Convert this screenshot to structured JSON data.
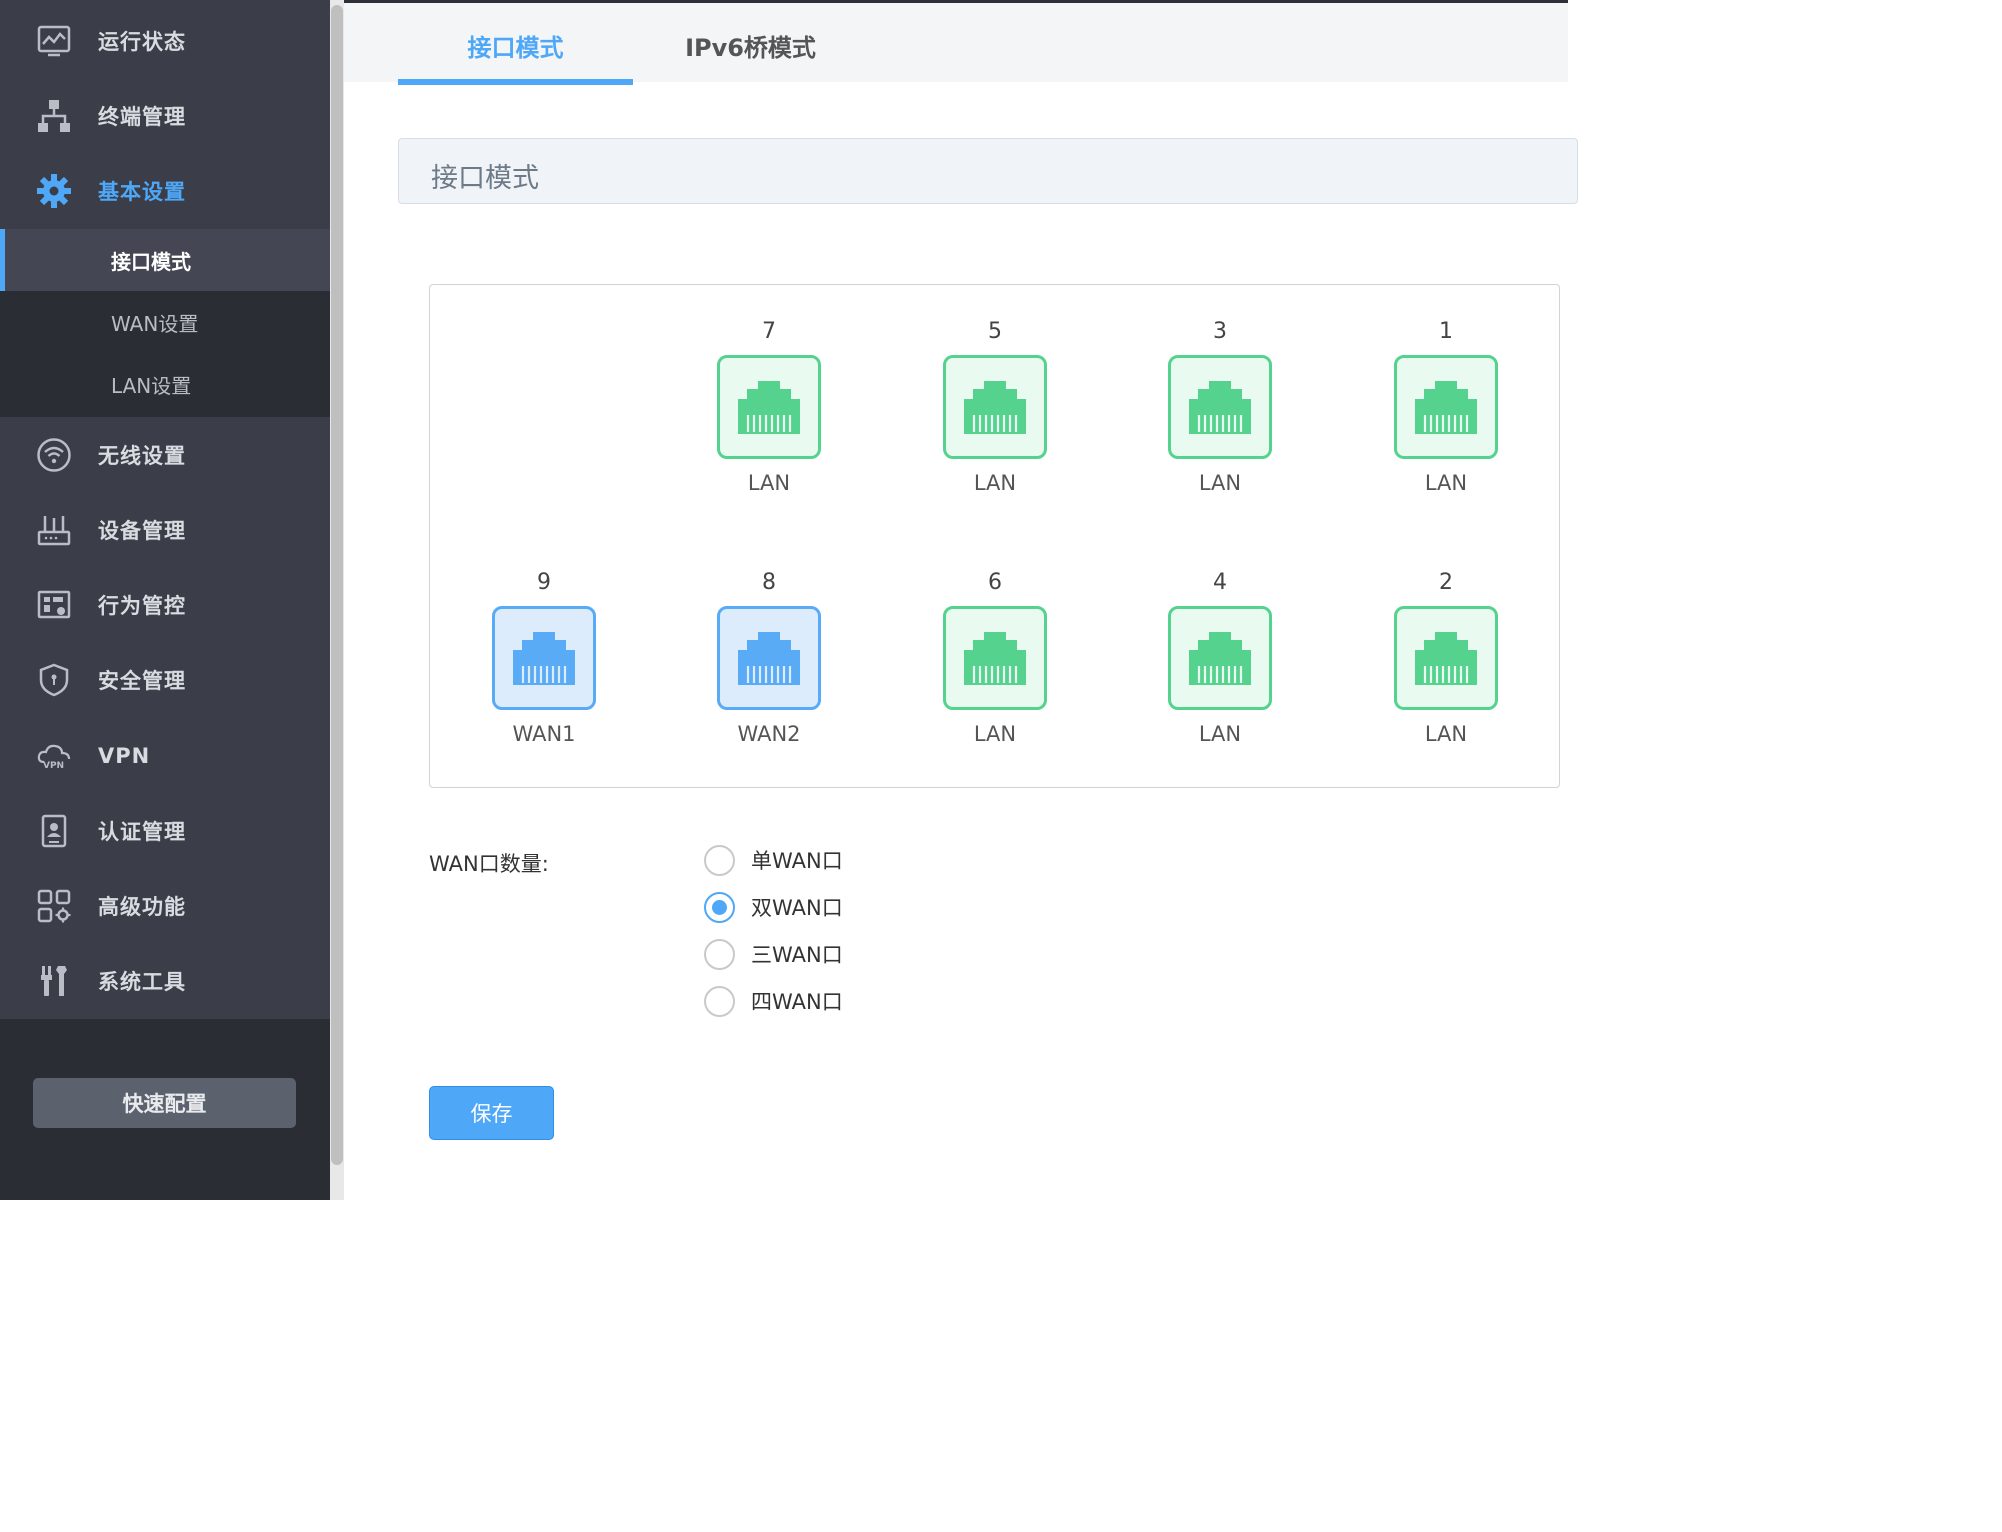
{
  "sidebar": {
    "items": [
      {
        "label": "运行状态",
        "icon": "monitor-chart-icon"
      },
      {
        "label": "终端管理",
        "icon": "network-tree-icon"
      },
      {
        "label": "基本设置",
        "icon": "gear-icon",
        "active": true
      },
      {
        "label": "无线设置",
        "icon": "wifi-icon"
      },
      {
        "label": "设备管理",
        "icon": "router-device-icon"
      },
      {
        "label": "行为管控",
        "icon": "behavior-control-icon"
      },
      {
        "label": "安全管理",
        "icon": "shield-icon"
      },
      {
        "label": "VPN",
        "icon": "vpn-cloud-icon"
      },
      {
        "label": "认证管理",
        "icon": "auth-badge-icon"
      },
      {
        "label": "高级功能",
        "icon": "advanced-grid-icon"
      },
      {
        "label": "系统工具",
        "icon": "tools-icon"
      }
    ],
    "submenu": [
      {
        "label": "接口模式",
        "selected": true
      },
      {
        "label": "WAN设置"
      },
      {
        "label": "LAN设置"
      }
    ],
    "quick_config": "快速配置"
  },
  "tabs": [
    {
      "label": "接口模式",
      "active": true
    },
    {
      "label": "IPv6桥模式"
    }
  ],
  "section_title": "接口模式",
  "ports": {
    "top_row": [
      {
        "number": "7",
        "label": "LAN",
        "type": "lan"
      },
      {
        "number": "5",
        "label": "LAN",
        "type": "lan"
      },
      {
        "number": "3",
        "label": "LAN",
        "type": "lan"
      },
      {
        "number": "1",
        "label": "LAN",
        "type": "lan"
      }
    ],
    "bottom_row": [
      {
        "number": "9",
        "label": "WAN1",
        "type": "wan"
      },
      {
        "number": "8",
        "label": "WAN2",
        "type": "wan"
      },
      {
        "number": "6",
        "label": "LAN",
        "type": "lan"
      },
      {
        "number": "4",
        "label": "LAN",
        "type": "lan"
      },
      {
        "number": "2",
        "label": "LAN",
        "type": "lan"
      }
    ]
  },
  "wan_count": {
    "label": "WAN口数量:",
    "options": [
      {
        "label": "单WAN口",
        "checked": false
      },
      {
        "label": "双WAN口",
        "checked": true
      },
      {
        "label": "三WAN口",
        "checked": false
      },
      {
        "label": "四WAN口",
        "checked": false
      }
    ]
  },
  "save_label": "保存",
  "colors": {
    "accent": "#4ea7f7",
    "lan_green": "#55d28e",
    "wan_blue": "#5aabf6",
    "sidebar_bg": "#3b3e48"
  }
}
